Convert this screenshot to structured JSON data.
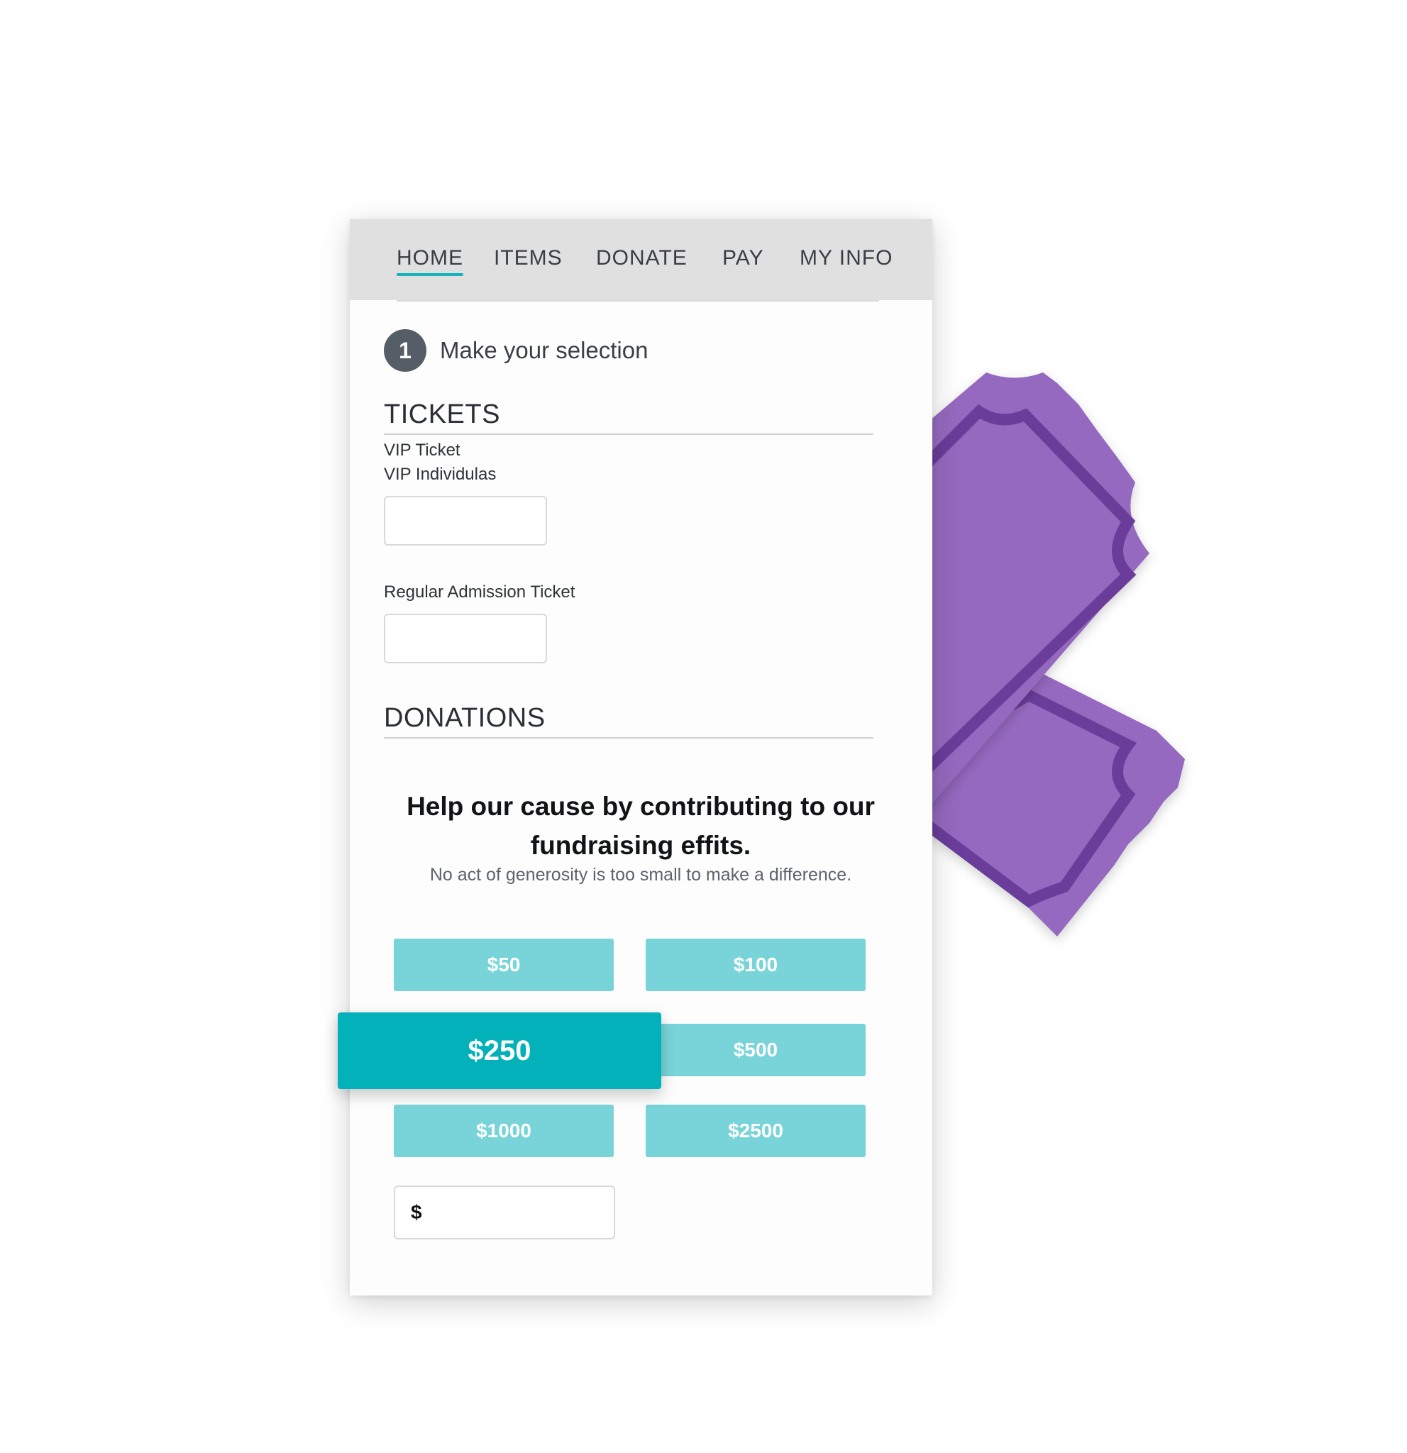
{
  "nav": {
    "items": [
      "HOME",
      "ITEMS",
      "DONATE",
      "PAY",
      "MY INFO"
    ],
    "active": "HOME"
  },
  "step": {
    "number": "1",
    "title": "Make your selection"
  },
  "tickets": {
    "heading": "TICKETS",
    "vip_label_line1": "VIP Ticket",
    "vip_label_line2": "VIP Individulas",
    "regular_label": "Regular Admission Ticket"
  },
  "donations": {
    "heading": "DONATIONS",
    "headline": "Help our cause by contributing to our fundraising effits.",
    "subtext": "No act of generosity is too small to make a difference.",
    "amounts": [
      "$50",
      "$100",
      "$250",
      "$500",
      "$1000",
      "$2500"
    ],
    "selected": "$250",
    "custom_prefix": "$"
  },
  "colors": {
    "accent": "#02b1b9",
    "amount_button": "#78d4d9",
    "ticket_fill": "#9569bf",
    "ticket_dark": "#6a3d9a",
    "nav_bg": "#e0e0e0"
  },
  "icons": {
    "decorative": "tickets-illustration"
  }
}
